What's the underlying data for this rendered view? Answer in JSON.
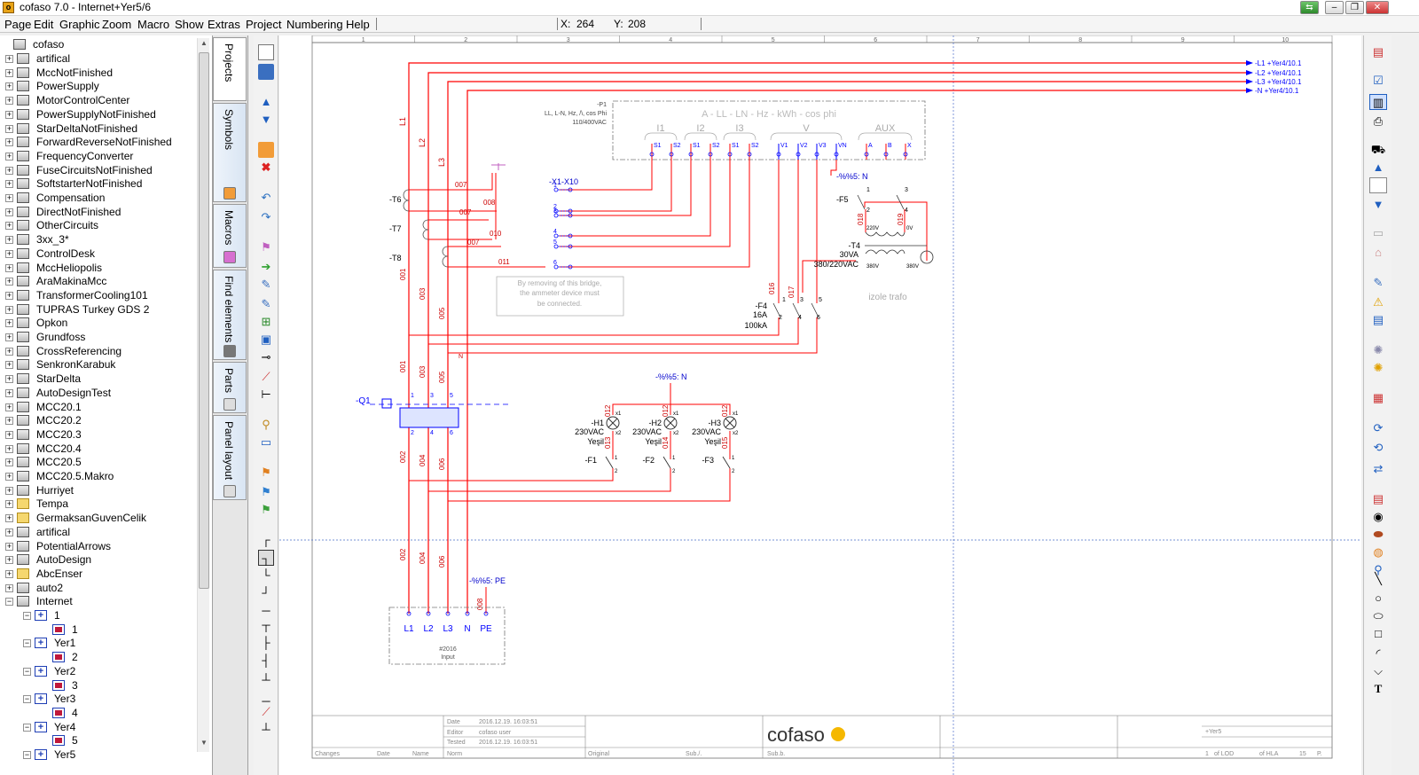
{
  "window": {
    "title": "cofaso 7.0 - Internet+Yer5/6",
    "app_icon": "o",
    "buttons": [
      "⇆",
      "–",
      "❐",
      "✕"
    ]
  },
  "menu": [
    "Page",
    "Edit",
    "Graphic",
    "Zoom",
    "Macro",
    "Show",
    "Extras",
    "Project",
    "Numbering",
    "Help"
  ],
  "status": {
    "x_label": "X:",
    "x_value": "264",
    "y_label": "Y:",
    "y_value": "208"
  },
  "tree": {
    "root": "cofaso",
    "items": [
      "artifical",
      "MccNotFinished",
      "PowerSupply",
      "MotorControlCenter",
      "PowerSupplyNotFinished",
      "StarDeltaNotFinished",
      "ForwardReverseNotFinished",
      "FrequencyConverter",
      "FuseCircuitsNotFinished",
      "SoftstarterNotFinished",
      "Compensation",
      "DirectNotFinished",
      "OtherCircuits",
      "3xx_3*",
      "ControlDesk",
      "MccHeliopolis",
      "AraMakinaMcc",
      "TransformerCooling101",
      "TUPRAS Turkey GDS 2",
      "Opkon",
      "Grundfoss",
      "CrossReferencing",
      "SenkronKarabuk",
      "StarDelta",
      "AutoDesignTest",
      "MCC20.1",
      "MCC20.2",
      "MCC20.3",
      "MCC20.4",
      "MCC20.5",
      "MCC20.5.Makro",
      "Hurriyet",
      "Tempa",
      "GermaksanGuvenCelik",
      "artifical",
      "PotentialArrows",
      "AutoDesign",
      "AbcEnser",
      "auto2",
      "Internet"
    ],
    "folder_items": [
      "Tempa",
      "GermaksanGuvenCelik",
      "AbcEnser"
    ],
    "internet_children": [
      {
        "label": "1",
        "page": "1"
      },
      {
        "label": "Yer1",
        "page": "2"
      },
      {
        "label": "Yer2",
        "page": "3"
      },
      {
        "label": "Yer3",
        "page": "4"
      },
      {
        "label": "Yer4",
        "page": "5"
      },
      {
        "label": "Yer5",
        "page": ""
      }
    ]
  },
  "tabs": [
    "Projects",
    "Symbols",
    "Macros",
    "Find elements",
    "Parts",
    "Panel layout"
  ],
  "ruler": [
    "1",
    "2",
    "3",
    "4",
    "5",
    "6",
    "7",
    "8",
    "9",
    "10"
  ],
  "schematic": {
    "wires_out": [
      "-L1 +Yer4/10.1",
      "-L2 +Yer4/10.1",
      "-L3 +Yer4/10.1",
      "-N +Yer4/10.1"
    ],
    "left_labels": [
      "L1",
      "L2",
      "L3"
    ],
    "meter": {
      "ref": "-P1",
      "desc1": "LL, L-N, Hz, /\\, cos Phi",
      "desc2": "110/400VAC",
      "header": "A - LL - LN - Hz - kWh - cos phi",
      "groups": [
        "I1",
        "I2",
        "I3",
        "V",
        "AUX"
      ],
      "pins": [
        "S1",
        "S2",
        "S1",
        "S2",
        "S1",
        "S2",
        "V1",
        "V2",
        "V3",
        "VN",
        "A",
        "B",
        "X"
      ]
    },
    "terminal_ref": "-X1-X10",
    "terminal_nums": [
      "1",
      "2",
      "3",
      "4",
      "5",
      "6"
    ],
    "ct_refs": [
      "-T6",
      "-T7",
      "-T8"
    ],
    "wire_nums": [
      "007",
      "008",
      "007",
      "010",
      "007",
      "011"
    ],
    "bridge_note": [
      "By removing of this bridge,",
      "the ammeter device must",
      "be connected."
    ],
    "vert_wires": [
      "001",
      "003",
      "005"
    ],
    "vert_wires2": [
      "001",
      "003",
      "005"
    ],
    "vert_wires3": [
      "002",
      "004",
      "006"
    ],
    "vert_wires4": [
      "002",
      "004",
      "006"
    ],
    "pot_n1": "-%%5: N",
    "pot_n2": "-%%5: N",
    "pot_pe": "-%%5: PE",
    "f5": {
      "ref": "-F5",
      "pins": [
        "1",
        "2",
        "3",
        "4"
      ],
      "wires": [
        "018",
        "019"
      ]
    },
    "t4": {
      "ref": "-T4",
      "rating": "30VA",
      "ratio": "380/220VAC",
      "sec1": "220V",
      "sec2": "0V",
      "pri1": "380V",
      "pri2": "380V",
      "note": "izole trafo"
    },
    "f4": {
      "ref": "-F4",
      "rating": "16A",
      "ic": "100kA",
      "wires": [
        "016",
        "017"
      ],
      "pins": [
        "1",
        "2",
        "3",
        "4",
        "5",
        "6"
      ]
    },
    "q1": {
      "ref": "-Q1",
      "pins_top": [
        "1",
        "3",
        "5"
      ],
      "pins_bot": [
        "2",
        "4",
        "6"
      ]
    },
    "lamps": [
      {
        "ref": "-H1",
        "volt": "230VAC",
        "color": "Yeşil",
        "w1": "012",
        "w2": "013",
        "f": "-F1"
      },
      {
        "ref": "-H2",
        "volt": "230VAC",
        "color": "Yeşil",
        "w1": "012",
        "w2": "014",
        "f": "-F2"
      },
      {
        "ref": "-H3",
        "volt": "230VAC",
        "color": "Yeşil",
        "w1": "012",
        "w2": "015",
        "f": "-F3"
      }
    ],
    "lamp_pins": [
      "x1",
      "x2"
    ],
    "f_pins": [
      "1",
      "2"
    ],
    "pe_wire": "008",
    "input_box": {
      "terminals": [
        "L1",
        "L2",
        "L3",
        "N",
        "PE"
      ],
      "id": "#2016",
      "name": "Input"
    }
  },
  "titleblock": {
    "date_label": "Date",
    "date_value": "2016.12.19. 16:03:51",
    "editor_label": "Editor",
    "editor_value": "cofaso user",
    "tested_label": "Tested",
    "tested_value": "2016.12.19. 16:03:51",
    "changes": "Changes",
    "date": "Date",
    "name": "Name",
    "norm": "Norm",
    "original": "Original",
    "subst": "Sub./.",
    "subs": "Sub.b.",
    "logo": "cofaso",
    "place": "+Yer5",
    "page_of": "1",
    "lod": "of LOD",
    "hla": "of HLA",
    "p15": "15",
    "pp": "P."
  },
  "colors": {
    "wire_red": "#ff0000",
    "blue": "#0000ff",
    "grey": "#808080",
    "darkred": "#c00000"
  }
}
